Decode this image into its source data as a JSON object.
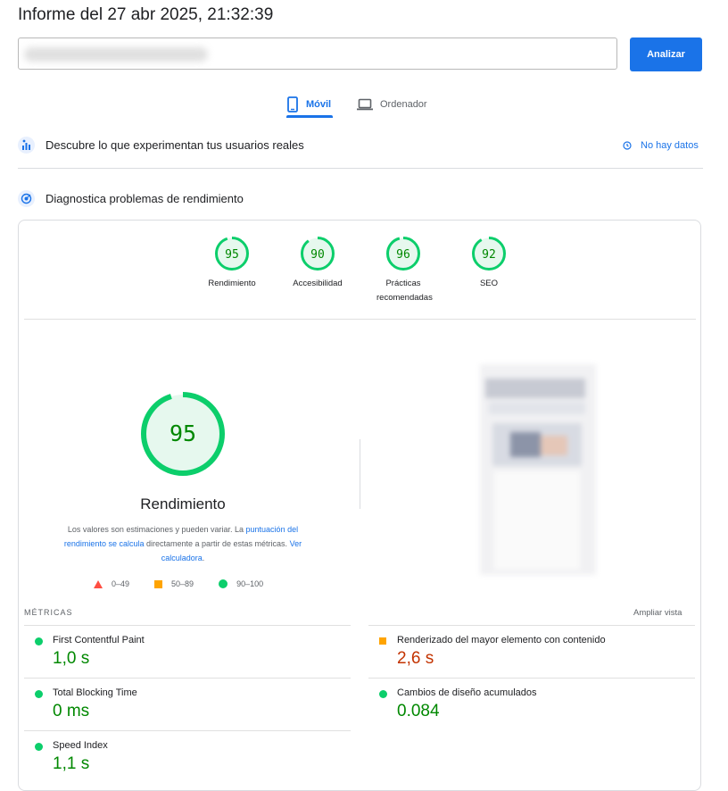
{
  "report_title": "Informe del 27 abr 2025, 21:32:39",
  "url_input": {
    "value": ""
  },
  "analyze_button": "Analizar",
  "tabs": [
    {
      "label": "Móvil",
      "icon": "smartphone-icon",
      "selected": true
    },
    {
      "label": "Ordenador",
      "icon": "laptop-icon",
      "selected": false
    }
  ],
  "field_data": {
    "title": "Descubre lo que experimentan tus usuarios reales",
    "status": "No hay datos"
  },
  "lab_data": {
    "title": "Diagnostica problemas de rendimiento"
  },
  "categories": [
    {
      "score": "95",
      "label": "Rendimiento",
      "value": 95
    },
    {
      "score": "90",
      "label": "Accesibilidad",
      "value": 90
    },
    {
      "score": "96",
      "label": "Prácticas recomendadas",
      "value": 96
    },
    {
      "score": "92",
      "label": "SEO",
      "value": 92
    }
  ],
  "performance": {
    "score": "95",
    "value": 95,
    "title": "Rendimiento",
    "desc_1": "Los valores son estimaciones y pueden variar. La ",
    "link_1": "puntuación del rendimiento se calcula",
    "desc_2": " directamente a partir de estas métricas. ",
    "link_2": "Ver calculadora",
    "desc_3": "."
  },
  "legend": {
    "fail": "0–49",
    "average": "50–89",
    "pass": "90–100"
  },
  "metrics_header": {
    "label": "MÉTRICAS",
    "expand": "Ampliar vista"
  },
  "metrics": [
    {
      "name": "First Contentful Paint",
      "value": "1,0 s",
      "rating": "pass"
    },
    {
      "name": "Renderizado del mayor elemento con contenido",
      "value": "2,6 s",
      "rating": "average"
    },
    {
      "name": "Total Blocking Time",
      "value": "0 ms",
      "rating": "pass"
    },
    {
      "name": "Cambios de diseño acumulados",
      "value": "0.084",
      "rating": "pass"
    },
    {
      "name": "Speed Index",
      "value": "1,1 s",
      "rating": "pass"
    }
  ],
  "colors": {
    "pass": "#0cce6b",
    "average": "#ffa400",
    "fail": "#ff4e42",
    "accent": "#1a73e8"
  }
}
